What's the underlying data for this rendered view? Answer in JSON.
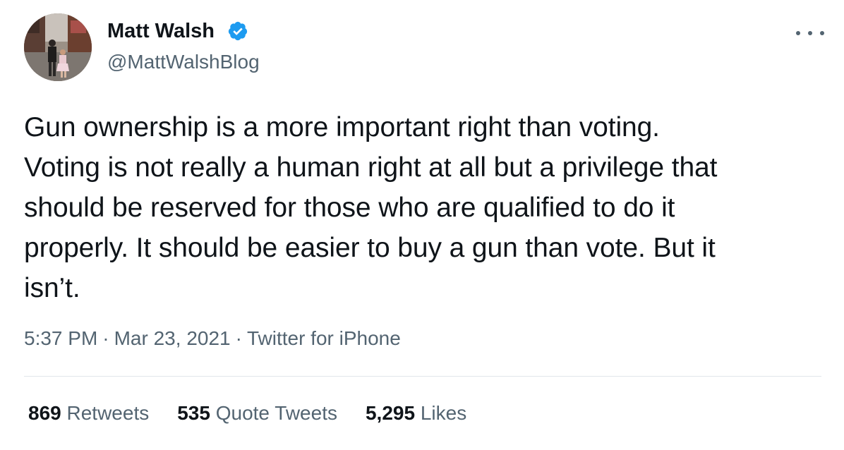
{
  "author": {
    "name": "Matt Walsh",
    "handle": "@MattWalshBlog",
    "verified": true
  },
  "tweet": {
    "lines": [
      "Gun ownership is a more important right than voting.",
      "Voting is not really a human right at all but a privilege that",
      "should be reserved for those who are qualified to do it",
      "properly. It should be easier to buy a gun than vote. But it",
      "isn’t."
    ]
  },
  "meta": {
    "time": "5:37 PM",
    "separator": "·",
    "date": "Mar 23, 2021",
    "source": "Twitter for iPhone"
  },
  "stats": {
    "retweets_count": "869",
    "retweets_label": "Retweets",
    "quotes_count": "535",
    "quotes_label": "Quote Tweets",
    "likes_count": "5,295",
    "likes_label": "Likes"
  },
  "icons": {
    "verified": "verified-badge-icon",
    "more": "more-options-icon"
  },
  "colors": {
    "text_primary": "#0f1419",
    "text_secondary": "#536471",
    "verified_blue": "#1d9bf0",
    "divider": "#e1e6ea"
  }
}
